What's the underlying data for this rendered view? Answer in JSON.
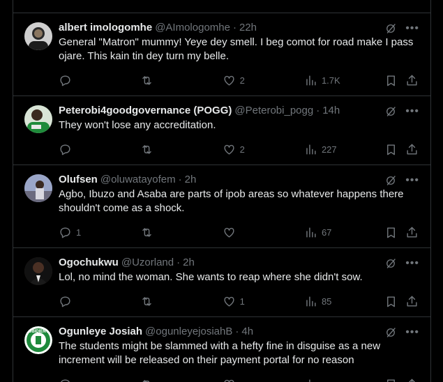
{
  "tweets": [
    {
      "name": "albert imologomhe",
      "handle": "@AImologomhe",
      "time": "22h",
      "text": "General \"Matron\" mummy! Yeye dey smell. I beg comot for road make I pass ojare. This kain tin dey turn my belle.",
      "replies": "",
      "retweets": "",
      "likes": "2",
      "views": "1.7K",
      "avatar_color": "#6d6d6d"
    },
    {
      "name": "Peterobi4goodgovernance (POGG)",
      "handle": "@Peterobi_pogg",
      "time": "14h",
      "text": "They won't lose any accreditation.",
      "replies": "",
      "retweets": "",
      "likes": "2",
      "views": "227",
      "avatar_color": "#2f7a3a"
    },
    {
      "name": "Olufsen",
      "handle": "@oluwatayofem",
      "time": "2h",
      "text": "Agbo, Ibuzo and Asaba are parts of ipob areas so whatever happens there shouldn't come as a shock.",
      "replies": "1",
      "retweets": "",
      "likes": "",
      "views": "67",
      "avatar_color": "#7f7a9a"
    },
    {
      "name": "Ogochukwu",
      "handle": "@Uzorland",
      "time": "2h",
      "text": "Lol, no mind the woman. She wants to reap where she didn't sow.",
      "replies": "",
      "retweets": "",
      "likes": "1",
      "views": "85",
      "avatar_color": "#3a2a22"
    },
    {
      "name": "Ogunleye Josiah",
      "handle": "@ogunleyejosiahB",
      "time": "4h",
      "text": "The students might be slammed with a hefty fine in disguise as a new increment will be released on their payment portal for no reason",
      "replies": "",
      "retweets": "",
      "likes": "",
      "views": "",
      "avatar_color": "#1e8a3c",
      "avatar_label": "OBIDIENT"
    }
  ],
  "separator": "·",
  "colors": {
    "bg": "#000000",
    "text": "#e7e9ea",
    "muted": "#71767b",
    "border": "#2f3336"
  }
}
